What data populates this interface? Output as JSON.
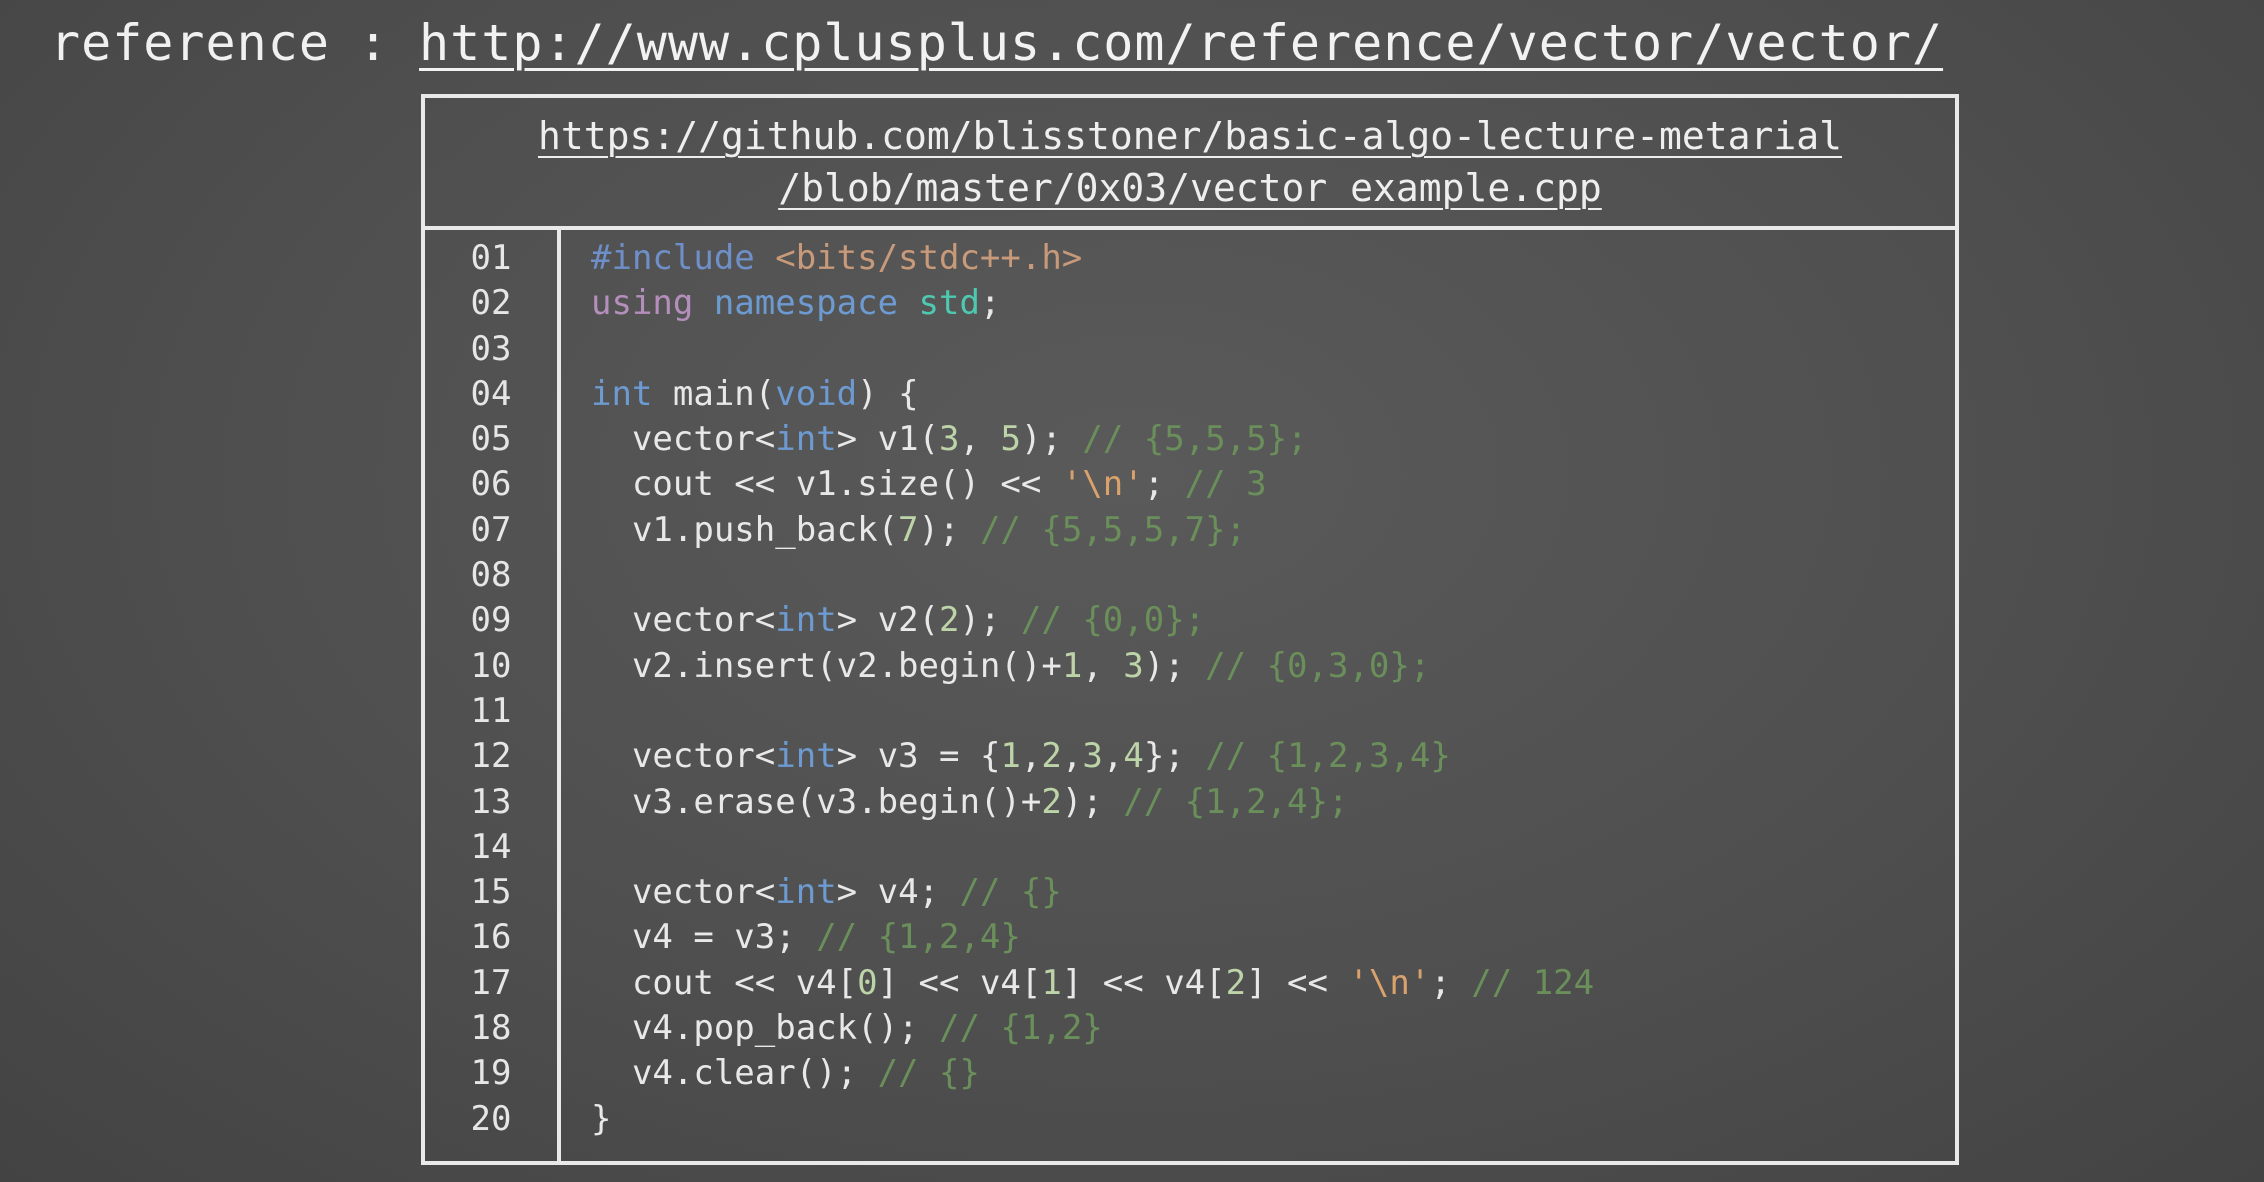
{
  "reference": {
    "label": "reference",
    "separator": ":",
    "url": "http://www.cplusplus.com/reference/vector/vector/"
  },
  "source": {
    "url_line_1": "https://github.com/blisstoner/basic-algo-lecture-metarial",
    "url_line_2": "/blob/master/0x03/vector_example.cpp"
  },
  "code": {
    "line_numbers": [
      "01",
      "02",
      "03",
      "04",
      "05",
      "06",
      "07",
      "08",
      "09",
      "10",
      "11",
      "12",
      "13",
      "14",
      "15",
      "16",
      "17",
      "18",
      "19",
      "20"
    ],
    "lines": [
      [
        {
          "t": "prep",
          "v": "#include "
        },
        {
          "t": "str",
          "v": "<bits/stdc++.h>"
        }
      ],
      [
        {
          "t": "kw",
          "v": "using "
        },
        {
          "t": "type",
          "v": "namespace "
        },
        {
          "t": "ns",
          "v": "std"
        },
        {
          "t": "plain",
          "v": ";"
        }
      ],
      [],
      [
        {
          "t": "type",
          "v": "int "
        },
        {
          "t": "plain",
          "v": "main("
        },
        {
          "t": "type",
          "v": "void"
        },
        {
          "t": "plain",
          "v": ") {"
        }
      ],
      [
        {
          "t": "plain",
          "v": "  vector<"
        },
        {
          "t": "type",
          "v": "int"
        },
        {
          "t": "plain",
          "v": "> v1("
        },
        {
          "t": "num",
          "v": "3"
        },
        {
          "t": "plain",
          "v": ", "
        },
        {
          "t": "num",
          "v": "5"
        },
        {
          "t": "plain",
          "v": "); "
        },
        {
          "t": "com",
          "v": "// {5,5,5};"
        }
      ],
      [
        {
          "t": "plain",
          "v": "  cout << v1.size() << "
        },
        {
          "t": "chr",
          "v": "'\\n'"
        },
        {
          "t": "plain",
          "v": "; "
        },
        {
          "t": "com",
          "v": "// 3"
        }
      ],
      [
        {
          "t": "plain",
          "v": "  v1.push_back("
        },
        {
          "t": "num",
          "v": "7"
        },
        {
          "t": "plain",
          "v": "); "
        },
        {
          "t": "com",
          "v": "// {5,5,5,7};"
        }
      ],
      [],
      [
        {
          "t": "plain",
          "v": "  vector<"
        },
        {
          "t": "type",
          "v": "int"
        },
        {
          "t": "plain",
          "v": "> v2("
        },
        {
          "t": "num",
          "v": "2"
        },
        {
          "t": "plain",
          "v": "); "
        },
        {
          "t": "com",
          "v": "// {0,0};"
        }
      ],
      [
        {
          "t": "plain",
          "v": "  v2.insert(v2.begin()+"
        },
        {
          "t": "num",
          "v": "1"
        },
        {
          "t": "plain",
          "v": ", "
        },
        {
          "t": "num",
          "v": "3"
        },
        {
          "t": "plain",
          "v": "); "
        },
        {
          "t": "com",
          "v": "// {0,3,0};"
        }
      ],
      [],
      [
        {
          "t": "plain",
          "v": "  vector<"
        },
        {
          "t": "type",
          "v": "int"
        },
        {
          "t": "plain",
          "v": "> v3 = {"
        },
        {
          "t": "num",
          "v": "1"
        },
        {
          "t": "plain",
          "v": ","
        },
        {
          "t": "num",
          "v": "2"
        },
        {
          "t": "plain",
          "v": ","
        },
        {
          "t": "num",
          "v": "3"
        },
        {
          "t": "plain",
          "v": ","
        },
        {
          "t": "num",
          "v": "4"
        },
        {
          "t": "plain",
          "v": "}; "
        },
        {
          "t": "com",
          "v": "// {1,2,3,4}"
        }
      ],
      [
        {
          "t": "plain",
          "v": "  v3.erase(v3.begin()+"
        },
        {
          "t": "num",
          "v": "2"
        },
        {
          "t": "plain",
          "v": "); "
        },
        {
          "t": "com",
          "v": "// {1,2,4};"
        }
      ],
      [],
      [
        {
          "t": "plain",
          "v": "  vector<"
        },
        {
          "t": "type",
          "v": "int"
        },
        {
          "t": "plain",
          "v": "> v4; "
        },
        {
          "t": "com",
          "v": "// {}"
        }
      ],
      [
        {
          "t": "plain",
          "v": "  v4 = v3; "
        },
        {
          "t": "com",
          "v": "// {1,2,4}"
        }
      ],
      [
        {
          "t": "plain",
          "v": "  cout << v4["
        },
        {
          "t": "num",
          "v": "0"
        },
        {
          "t": "plain",
          "v": "] << v4["
        },
        {
          "t": "num",
          "v": "1"
        },
        {
          "t": "plain",
          "v": "] << v4["
        },
        {
          "t": "num",
          "v": "2"
        },
        {
          "t": "plain",
          "v": "] << "
        },
        {
          "t": "chr",
          "v": "'\\n'"
        },
        {
          "t": "plain",
          "v": "; "
        },
        {
          "t": "com",
          "v": "// 124"
        }
      ],
      [
        {
          "t": "plain",
          "v": "  v4.pop_back(); "
        },
        {
          "t": "com",
          "v": "// {1,2}"
        }
      ],
      [
        {
          "t": "plain",
          "v": "  v4.clear(); "
        },
        {
          "t": "com",
          "v": "// {}"
        }
      ],
      [
        {
          "t": "plain",
          "v": "}"
        }
      ]
    ]
  }
}
